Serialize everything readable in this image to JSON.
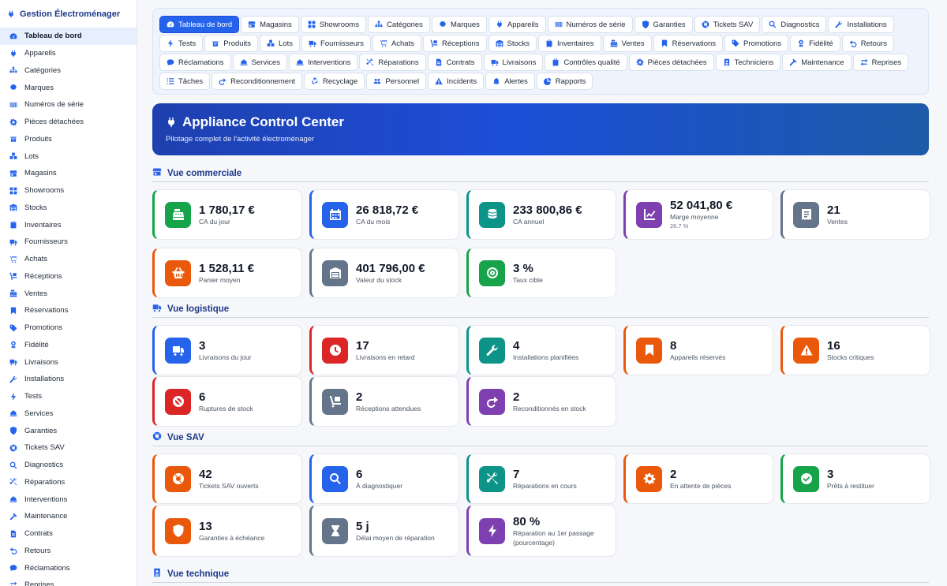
{
  "sidebar": {
    "title": "Gestion Électroménager",
    "items": [
      {
        "label": "Tableau de bord",
        "icon": "dashboard-icon"
      },
      {
        "label": "Appareils",
        "icon": "plug-icon"
      },
      {
        "label": "Catégories",
        "icon": "sitemap-icon"
      },
      {
        "label": "Marques",
        "icon": "badge-icon"
      },
      {
        "label": "Numéros de série",
        "icon": "barcode-icon"
      },
      {
        "label": "Pièces détachées",
        "icon": "gear-icon"
      },
      {
        "label": "Produits",
        "icon": "box-icon"
      },
      {
        "label": "Lots",
        "icon": "boxes-icon"
      },
      {
        "label": "Magasins",
        "icon": "store-icon"
      },
      {
        "label": "Showrooms",
        "icon": "grid-icon"
      },
      {
        "label": "Stocks",
        "icon": "warehouse-icon"
      },
      {
        "label": "Inventaires",
        "icon": "clipboard-icon"
      },
      {
        "label": "Fournisseurs",
        "icon": "truck-icon"
      },
      {
        "label": "Achats",
        "icon": "cart-icon"
      },
      {
        "label": "Réceptions",
        "icon": "dolly-icon"
      },
      {
        "label": "Ventes",
        "icon": "cash-register-icon"
      },
      {
        "label": "Réservations",
        "icon": "bookmark-icon"
      },
      {
        "label": "Promotions",
        "icon": "tag-icon"
      },
      {
        "label": "Fidélité",
        "icon": "award-icon"
      },
      {
        "label": "Livraisons",
        "icon": "truck-icon"
      },
      {
        "label": "Installations",
        "icon": "wrench-icon"
      },
      {
        "label": "Tests",
        "icon": "bolt-icon"
      },
      {
        "label": "Services",
        "icon": "service-bell-icon"
      },
      {
        "label": "Garanties",
        "icon": "shield-icon"
      },
      {
        "label": "Tickets SAV",
        "icon": "lifebuoy-icon"
      },
      {
        "label": "Diagnostics",
        "icon": "search-icon"
      },
      {
        "label": "Réparations",
        "icon": "tools-icon"
      },
      {
        "label": "Interventions",
        "icon": "service-bell-icon"
      },
      {
        "label": "Maintenance",
        "icon": "hammer-icon"
      },
      {
        "label": "Contrats",
        "icon": "file-icon"
      },
      {
        "label": "Retours",
        "icon": "undo-icon"
      },
      {
        "label": "Réclamations",
        "icon": "comment-icon"
      },
      {
        "label": "Reprises",
        "icon": "exchange-icon"
      }
    ]
  },
  "tabs": [
    {
      "label": "Tableau de bord",
      "icon": "dashboard-icon",
      "active": true
    },
    {
      "label": "Magasins",
      "icon": "store-icon"
    },
    {
      "label": "Showrooms",
      "icon": "grid-icon"
    },
    {
      "label": "Catégories",
      "icon": "sitemap-icon"
    },
    {
      "label": "Marques",
      "icon": "badge-icon"
    },
    {
      "label": "Appareils",
      "icon": "plug-icon"
    },
    {
      "label": "Numéros de série",
      "icon": "barcode-icon"
    },
    {
      "label": "Garanties",
      "icon": "shield-icon"
    },
    {
      "label": "Tickets SAV",
      "icon": "lifebuoy-icon"
    },
    {
      "label": "Diagnostics",
      "icon": "search-icon"
    },
    {
      "label": "Installations",
      "icon": "wrench-icon"
    },
    {
      "label": "Tests",
      "icon": "bolt-icon"
    },
    {
      "label": "Produits",
      "icon": "box-icon"
    },
    {
      "label": "Lots",
      "icon": "boxes-icon"
    },
    {
      "label": "Fournisseurs",
      "icon": "truck-icon"
    },
    {
      "label": "Achats",
      "icon": "cart-icon"
    },
    {
      "label": "Réceptions",
      "icon": "dolly-icon"
    },
    {
      "label": "Stocks",
      "icon": "warehouse-icon"
    },
    {
      "label": "Inventaires",
      "icon": "clipboard-icon"
    },
    {
      "label": "Ventes",
      "icon": "cash-register-icon"
    },
    {
      "label": "Réservations",
      "icon": "bookmark-icon"
    },
    {
      "label": "Promotions",
      "icon": "tag-icon"
    },
    {
      "label": "Fidélité",
      "icon": "award-icon"
    },
    {
      "label": "Retours",
      "icon": "undo-icon"
    },
    {
      "label": "Réclamations",
      "icon": "comment-icon"
    },
    {
      "label": "Services",
      "icon": "service-bell-icon"
    },
    {
      "label": "Interventions",
      "icon": "service-bell-icon"
    },
    {
      "label": "Réparations",
      "icon": "tools-icon"
    },
    {
      "label": "Contrats",
      "icon": "file-icon"
    },
    {
      "label": "Livraisons",
      "icon": "truck-icon"
    },
    {
      "label": "Contrôles qualité",
      "icon": "clipboard-check-icon"
    },
    {
      "label": "Pièces détachées",
      "icon": "gear-icon"
    },
    {
      "label": "Techniciens",
      "icon": "id-badge-icon"
    },
    {
      "label": "Maintenance",
      "icon": "hammer-icon"
    },
    {
      "label": "Reprises",
      "icon": "exchange-icon"
    },
    {
      "label": "Tâches",
      "icon": "list-icon"
    },
    {
      "label": "Reconditionnement",
      "icon": "redo-icon"
    },
    {
      "label": "Recyclage",
      "icon": "recycle-icon"
    },
    {
      "label": "Personnel",
      "icon": "users-icon"
    },
    {
      "label": "Incidents",
      "icon": "warning-icon"
    },
    {
      "label": "Alertes",
      "icon": "bell-icon"
    },
    {
      "label": "Rapports",
      "icon": "pie-chart-icon"
    }
  ],
  "hero": {
    "title": "Appliance Control Center",
    "subtitle": "Pilotage complet de l'activité électroménager"
  },
  "sections": [
    {
      "title": "Vue commerciale",
      "icon": "store-icon",
      "cards": [
        {
          "value": "1 780,17 €",
          "label": "CA du jour",
          "icon": "cash-register-icon",
          "color": "green"
        },
        {
          "value": "26 818,72 €",
          "label": "CA du mois",
          "icon": "calendar-icon",
          "color": "blue"
        },
        {
          "value": "233 800,86 €",
          "label": "CA annuel",
          "icon": "coins-icon",
          "color": "teal"
        },
        {
          "value": "52 041,80 €",
          "label": "Marge moyenne",
          "sub": "26.7 %",
          "icon": "chart-line-icon",
          "color": "purple"
        },
        {
          "value": "21",
          "label": "Ventes",
          "icon": "receipt-icon",
          "color": "slate"
        },
        {
          "value": "1 528,11 €",
          "label": "Panier moyen",
          "icon": "basket-icon",
          "color": "orange"
        },
        {
          "value": "401 796,00 €",
          "label": "Valeur du stock",
          "icon": "warehouse-icon",
          "color": "slate"
        },
        {
          "value": "3 %",
          "label": "Taux cible",
          "icon": "target-icon",
          "color": "green"
        }
      ]
    },
    {
      "title": "Vue logistique",
      "icon": "truck-icon",
      "cards": [
        {
          "value": "3",
          "label": "Livraisons du jour",
          "icon": "truck-icon",
          "color": "blue"
        },
        {
          "value": "17",
          "label": "Livraisons en retard",
          "icon": "clock-icon",
          "color": "red"
        },
        {
          "value": "4",
          "label": "Installations planifiées",
          "icon": "wrench-icon",
          "color": "teal"
        },
        {
          "value": "8",
          "label": "Appareils réservés",
          "icon": "bookmark-icon",
          "color": "orange"
        },
        {
          "value": "16",
          "label": "Stocks critiques",
          "icon": "warning-icon",
          "color": "orange"
        },
        {
          "value": "6",
          "label": "Ruptures de stock",
          "icon": "ban-icon",
          "color": "red"
        },
        {
          "value": "2",
          "label": "Réceptions attendues",
          "icon": "dolly-icon",
          "color": "slate"
        },
        {
          "value": "2",
          "label": "Reconditionnés en stock",
          "icon": "redo-icon",
          "color": "purple"
        }
      ]
    },
    {
      "title": "Vue SAV",
      "icon": "lifebuoy-icon",
      "cards": [
        {
          "value": "42",
          "label": "Tickets SAV ouverts",
          "icon": "lifebuoy-icon",
          "color": "orange"
        },
        {
          "value": "6",
          "label": "À diagnostiquer",
          "icon": "search-icon",
          "color": "blue"
        },
        {
          "value": "7",
          "label": "Réparations en cours",
          "icon": "tools-icon",
          "color": "teal"
        },
        {
          "value": "2",
          "label": "En attente de pièces",
          "icon": "gear-icon",
          "color": "orange"
        },
        {
          "value": "3",
          "label": "Prêts à restituer",
          "icon": "check-circle-icon",
          "color": "green"
        },
        {
          "value": "13",
          "label": "Garanties à échéance",
          "icon": "shield-icon",
          "color": "orange"
        },
        {
          "value": "5 j",
          "label": "Délai moyen de réparation",
          "icon": "hourglass-icon",
          "color": "slate"
        },
        {
          "value": "80 %",
          "label": "Réparation au 1er passage (pourcentage)",
          "icon": "bolt-icon",
          "color": "purple"
        }
      ]
    },
    {
      "title": "Vue technique",
      "icon": "id-badge-icon",
      "cards": []
    }
  ]
}
